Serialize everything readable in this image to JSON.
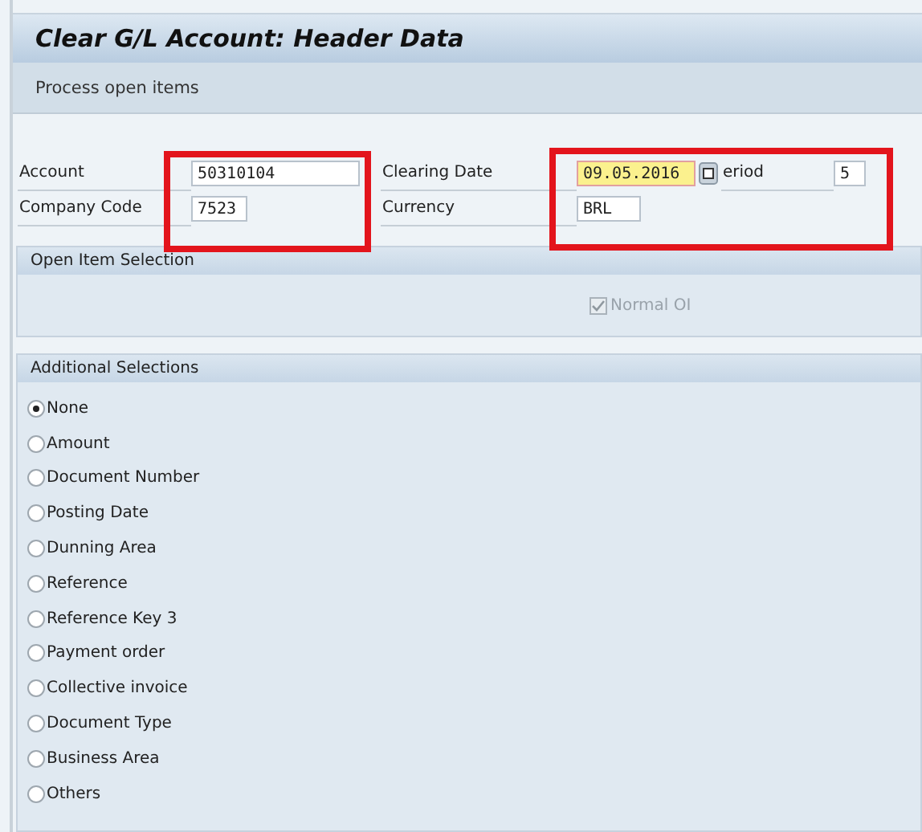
{
  "window": {
    "title": "Clear G/L Account: Header Data"
  },
  "toolbar": {
    "items": [
      {
        "label": "Process open items"
      }
    ]
  },
  "header_fields": {
    "account": {
      "label": "Account",
      "value": "50310104"
    },
    "company_code": {
      "label": "Company Code",
      "value": "7523"
    },
    "clearing_date": {
      "label": "Clearing Date",
      "value": "09.05.2016",
      "focused": true
    },
    "period": {
      "label": "eriod",
      "value": "5"
    },
    "currency": {
      "label": "Currency",
      "value": "BRL"
    }
  },
  "open_item_selection": {
    "title": "Open Item Selection",
    "options": [
      {
        "label": "Normal OI",
        "checked": true,
        "disabled": true
      }
    ]
  },
  "additional_selections": {
    "title": "Additional Selections",
    "options": [
      {
        "label": "None",
        "selected": true
      },
      {
        "label": "Amount",
        "selected": false
      },
      {
        "label": "Document Number",
        "selected": false
      },
      {
        "label": "Posting Date",
        "selected": false
      },
      {
        "label": "Dunning Area",
        "selected": false
      },
      {
        "label": "Reference",
        "selected": false
      },
      {
        "label": "Reference Key 3",
        "selected": false
      },
      {
        "label": "Payment order",
        "selected": false
      },
      {
        "label": "Collective invoice",
        "selected": false
      },
      {
        "label": "Document Type",
        "selected": false
      },
      {
        "label": "Business Area",
        "selected": false
      },
      {
        "label": "Others",
        "selected": false
      }
    ]
  }
}
